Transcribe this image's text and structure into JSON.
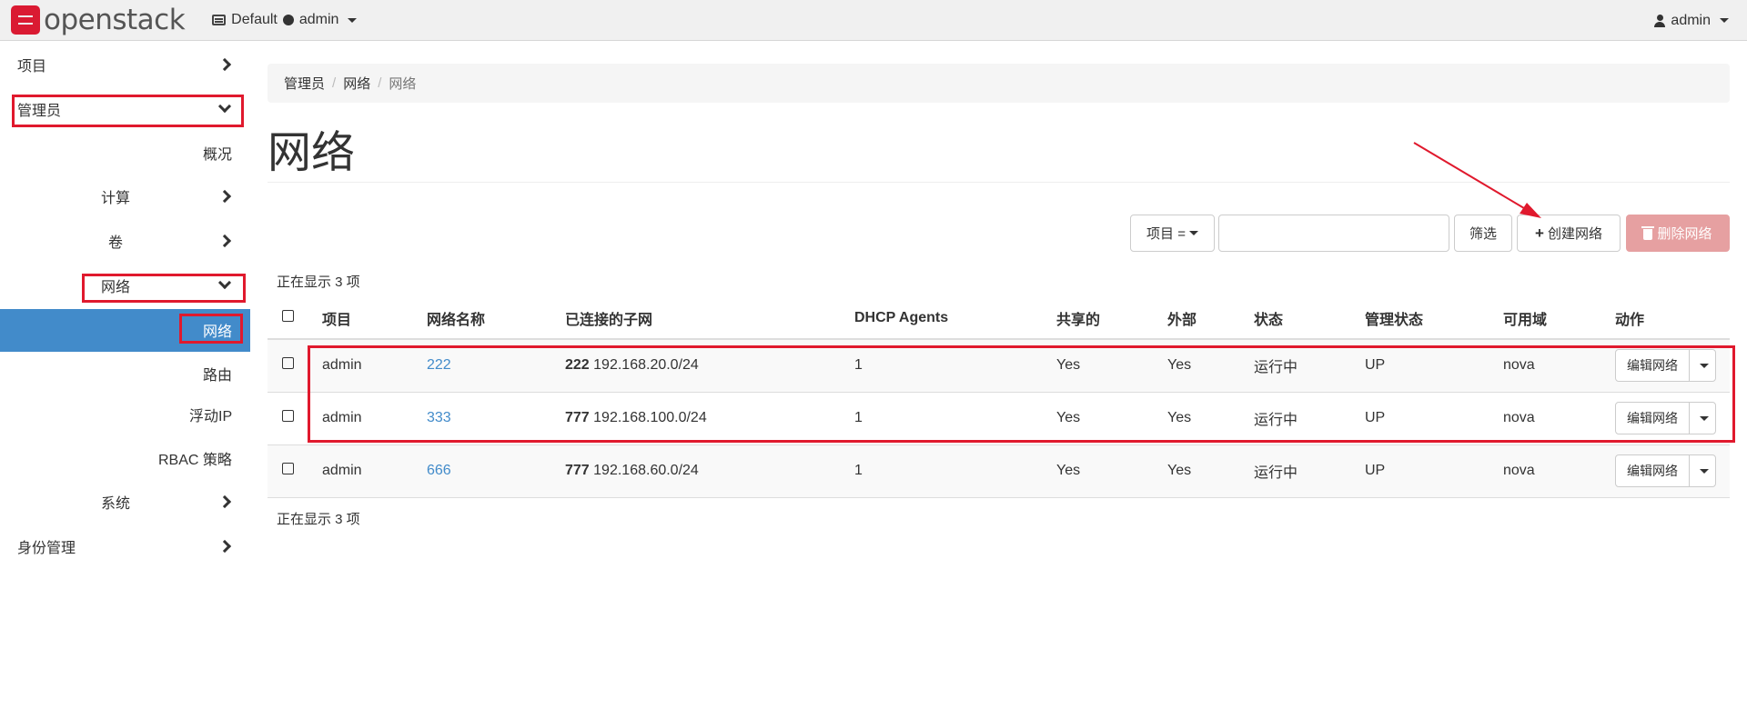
{
  "navbar": {
    "brand": "openstack",
    "domain": "Default",
    "project": "admin",
    "user": "admin"
  },
  "sidebar": {
    "project": "项目",
    "admin": "管理员",
    "overview": "概况",
    "compute": "计算",
    "volume": "卷",
    "network": "网络",
    "networks": "网络",
    "routers": "路由",
    "floating_ips": "浮动IP",
    "rbac": "RBAC 策略",
    "system": "系统",
    "identity": "身份管理"
  },
  "breadcrumb": [
    "管理员",
    "网络",
    "网络"
  ],
  "page_title": "网络",
  "toolbar": {
    "filter_field": "项目 =",
    "filter_value": "",
    "filter_button": "筛选",
    "create_button": "创建网络",
    "delete_button": "删除网络"
  },
  "count_text": "正在显示 3 项",
  "table": {
    "columns": [
      "项目",
      "网络名称",
      "已连接的子网",
      "DHCP Agents",
      "共享的",
      "外部",
      "状态",
      "管理状态",
      "可用域",
      "动作"
    ],
    "rows": [
      {
        "project": "admin",
        "name": "222",
        "subnet_name": "222",
        "subnet_cidr": "192.168.20.0/24",
        "dhcp": "1",
        "shared": "Yes",
        "external": "Yes",
        "status": "运行中",
        "admin_state": "UP",
        "zone": "nova",
        "action": "编辑网络"
      },
      {
        "project": "admin",
        "name": "333",
        "subnet_name": "777",
        "subnet_cidr": "192.168.100.0/24",
        "dhcp": "1",
        "shared": "Yes",
        "external": "Yes",
        "status": "运行中",
        "admin_state": "UP",
        "zone": "nova",
        "action": "编辑网络"
      },
      {
        "project": "admin",
        "name": "666",
        "subnet_name": "777",
        "subnet_cidr": "192.168.60.0/24",
        "dhcp": "1",
        "shared": "Yes",
        "external": "Yes",
        "status": "运行中",
        "admin_state": "UP",
        "zone": "nova",
        "action": "编辑网络"
      }
    ]
  },
  "colors": {
    "accent": "#428bca",
    "highlight_box": "#e0192d",
    "danger_button": "#e6a0a1"
  }
}
